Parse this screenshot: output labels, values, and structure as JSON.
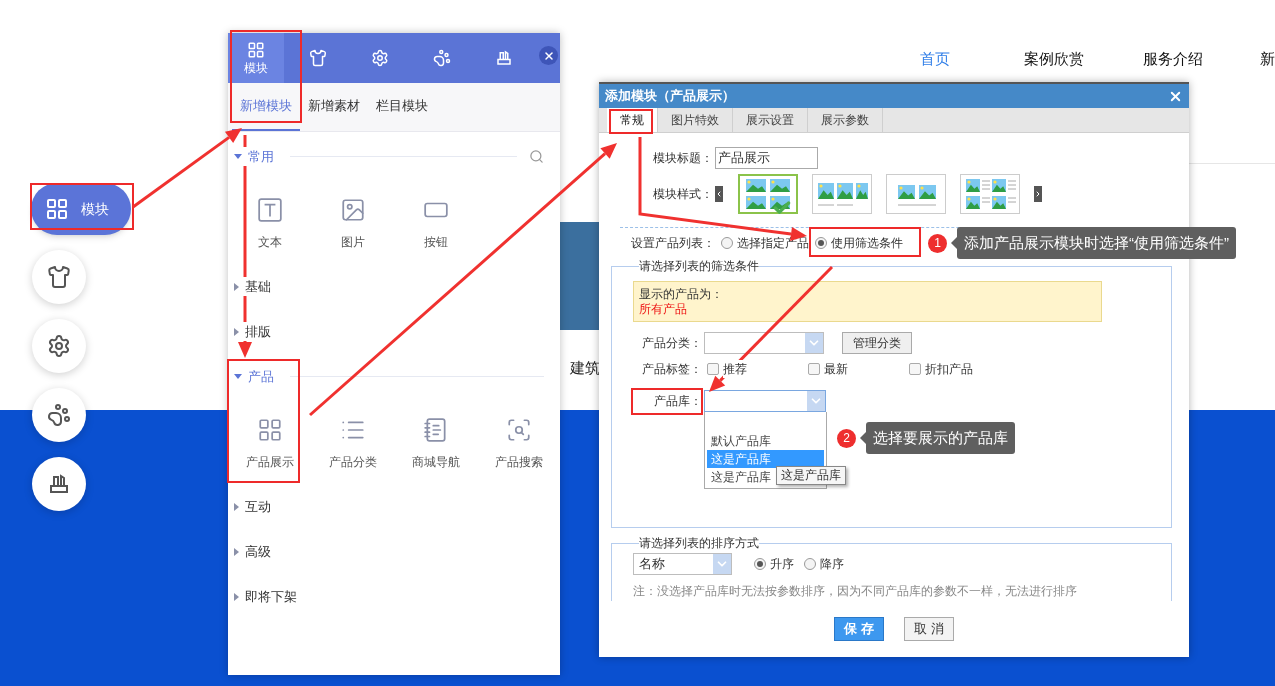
{
  "site_nav": [
    {
      "label": "首页",
      "selected": true
    },
    {
      "label": "案例欣赏",
      "selected": false
    },
    {
      "label": "服务介绍",
      "selected": false
    },
    {
      "label": "新",
      "selected": false
    }
  ],
  "page_caption": "建筑",
  "side_toolbar": [
    {
      "kind": "modules",
      "label": "模块",
      "selected": true
    },
    {
      "kind": "shirt",
      "selected": false
    },
    {
      "kind": "gear",
      "selected": false
    },
    {
      "kind": "paw",
      "selected": false
    },
    {
      "kind": "holder",
      "selected": false
    }
  ],
  "panel": {
    "tabs": [
      {
        "kind": "modules",
        "label": "模块",
        "selected": true
      },
      {
        "kind": "shirt",
        "selected": false
      },
      {
        "kind": "gear",
        "selected": false
      },
      {
        "kind": "paw",
        "selected": false
      },
      {
        "kind": "holder",
        "selected": false
      }
    ],
    "subtabs": [
      {
        "label": "新增模块",
        "selected": true
      },
      {
        "label": "新增素材",
        "selected": false
      },
      {
        "label": "栏目模块",
        "selected": false
      }
    ],
    "groups": [
      {
        "title": "常用",
        "expanded": true,
        "items": [
          {
            "kind": "text",
            "label": "文本"
          },
          {
            "kind": "image",
            "label": "图片"
          },
          {
            "kind": "button",
            "label": "按钮"
          }
        ]
      },
      {
        "title": "基础",
        "expanded": false
      },
      {
        "title": "排版",
        "expanded": false
      },
      {
        "title": "产品",
        "expanded": true,
        "items": [
          {
            "kind": "product-grid",
            "label": "产品展示"
          },
          {
            "kind": "product-list",
            "label": "产品分类"
          },
          {
            "kind": "shop-nav",
            "label": "商城导航"
          },
          {
            "kind": "product-search",
            "label": "产品搜索"
          }
        ]
      },
      {
        "title": "互动",
        "expanded": false
      },
      {
        "title": "高级",
        "expanded": false
      },
      {
        "title": "即将下架",
        "expanded": false
      }
    ]
  },
  "dialog": {
    "title": "添加模块（产品展示）",
    "tabs": [
      {
        "label": "常规",
        "selected": true
      },
      {
        "label": "图片特效",
        "selected": false
      },
      {
        "label": "展示设置",
        "selected": false
      },
      {
        "label": "展示参数",
        "selected": false
      }
    ],
    "module_title": {
      "label": "模块标题：",
      "value": "产品展示"
    },
    "module_style": {
      "label": "模块样式：",
      "options": [
        {
          "kind": "grid",
          "selected": true
        },
        {
          "kind": "row",
          "selected": false
        },
        {
          "kind": "carousel",
          "selected": false
        },
        {
          "kind": "list",
          "selected": false
        }
      ]
    },
    "product_list": {
      "label": "设置产品列表：",
      "options": [
        {
          "label": "选择指定产品",
          "selected": false
        },
        {
          "label": "使用筛选条件",
          "selected": true
        }
      ]
    },
    "filter": {
      "legend": "请选择列表的筛选条件",
      "notice_label": "显示的产品为：",
      "notice_value": "所有产品",
      "category": {
        "label": "产品分类：",
        "button": "管理分类"
      },
      "tags": {
        "label": "产品标签：",
        "options": [
          {
            "label": "推荐",
            "checked": false
          },
          {
            "label": "最新",
            "checked": false
          },
          {
            "label": "折扣产品",
            "checked": false
          }
        ]
      },
      "library": {
        "label": "产品库：",
        "options": [
          {
            "label": "默认产品库",
            "selected": false
          },
          {
            "label": "这是产品库",
            "selected": true
          },
          {
            "label": "这是产品库",
            "selected": false
          }
        ],
        "hover_tip": "这是产品库"
      }
    },
    "sort": {
      "legend": "请选择列表的排序方式",
      "field": "名称",
      "orders": [
        {
          "label": "升序",
          "selected": true
        },
        {
          "label": "降序",
          "selected": false
        }
      ],
      "note": "注：没选择产品库时无法按参数排序，因为不同产品库的参数不一样，无法进行排序"
    },
    "buttons": [
      {
        "label": "保 存",
        "kind": "primary"
      },
      {
        "label": "取 消",
        "kind": "secondary"
      }
    ]
  },
  "callouts": [
    {
      "number": "1",
      "text": "添加产品展示模块时选择“使用筛选条件”"
    },
    {
      "number": "2",
      "text": "选择要展示的产品库"
    }
  ]
}
